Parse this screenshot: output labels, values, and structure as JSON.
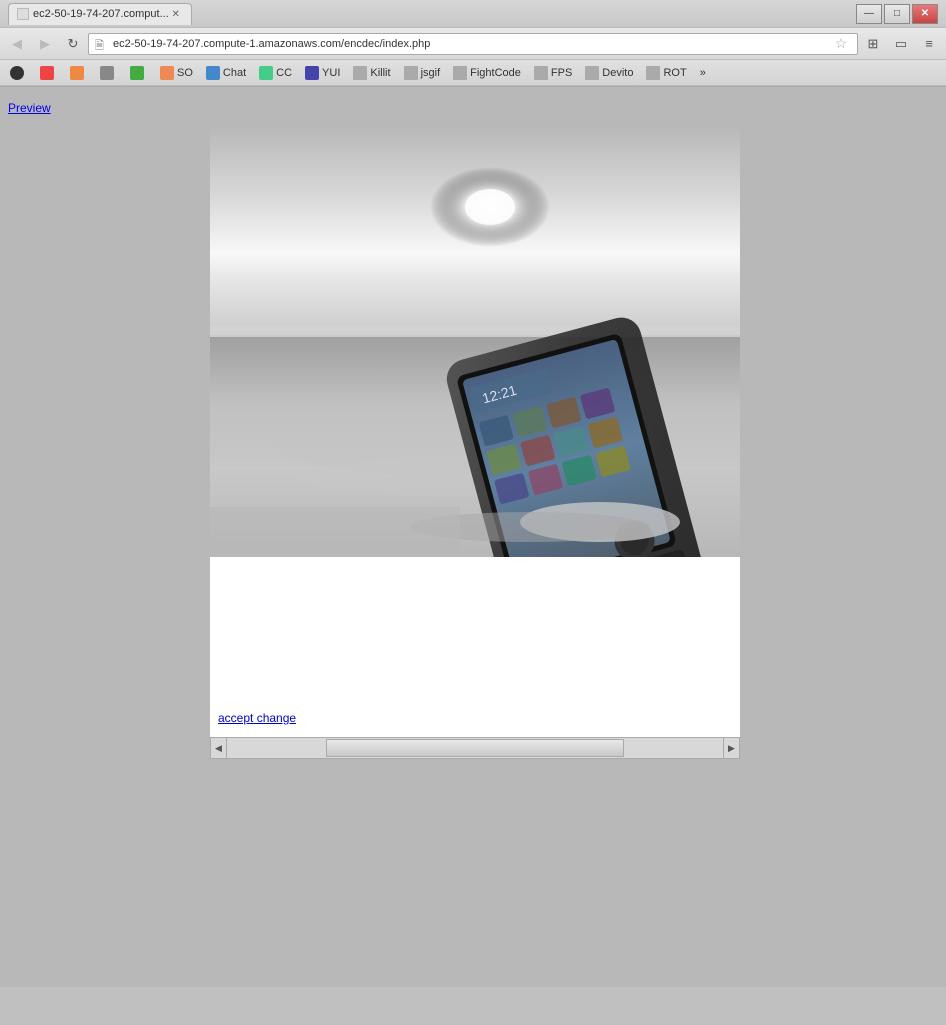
{
  "window": {
    "title": "ec2-50-19-74-207.comput...",
    "tab_label": "ec2-50-19-74-207.comput...",
    "controls": {
      "minimize": "—",
      "maximize": "□",
      "close": "✕"
    }
  },
  "nav": {
    "back": "◀",
    "forward": "▶",
    "refresh": "↻",
    "address": "ec2-50-19-74-207.compute-1.amazonaws.com/encdec/index.php",
    "star": "☆"
  },
  "bookmarks": [
    {
      "label": "",
      "favicon_class": "bk-github"
    },
    {
      "label": "",
      "favicon_class": "bk-red"
    },
    {
      "label": "",
      "favicon_class": "bk-orange"
    },
    {
      "label": "",
      "favicon_class": "bk-gray"
    },
    {
      "label": "",
      "favicon_class": "bk-green"
    },
    {
      "label": "Chat",
      "favicon_class": "bk-lightblue"
    },
    {
      "label": "CC",
      "favicon_class": "bk-cc"
    },
    {
      "label": "YUI",
      "favicon_class": "bk-blue"
    },
    {
      "label": "Killit",
      "favicon_class": "bk-doc"
    },
    {
      "label": "jsgif",
      "favicon_class": "bk-doc"
    },
    {
      "label": "FightCode",
      "favicon_class": "bk-doc"
    },
    {
      "label": "FPS",
      "favicon_class": "bk-doc"
    },
    {
      "label": "Devito",
      "favicon_class": "bk-doc"
    },
    {
      "label": "ROT",
      "favicon_class": "bk-doc"
    }
  ],
  "page": {
    "preview_link": "Preview",
    "accept_link": "accept change",
    "image_alt": "BlackBerry phone in sand at beach"
  }
}
